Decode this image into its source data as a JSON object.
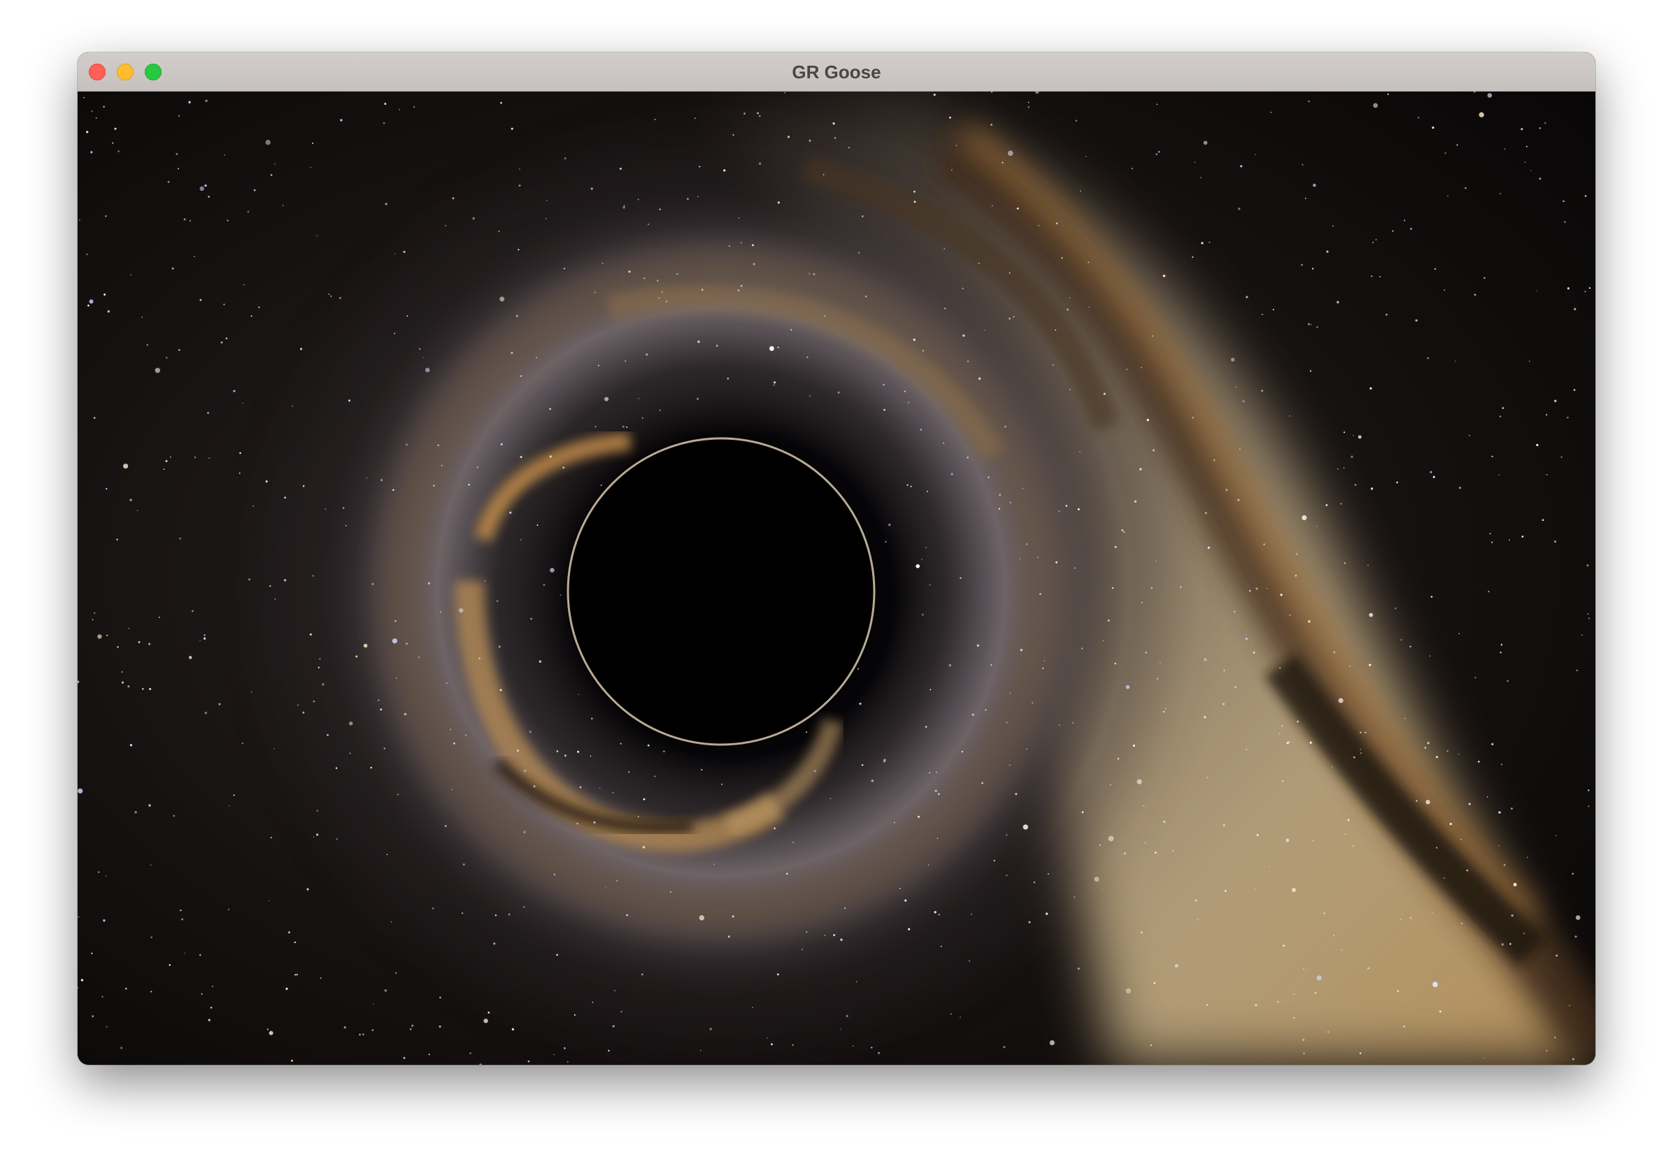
{
  "window": {
    "title": "GR Goose"
  },
  "controls": {
    "close_icon": "close-icon",
    "minimize_icon": "minimize-icon",
    "zoom_icon": "zoom-icon"
  },
  "colors": {
    "close": "#fe5f57",
    "minimize": "#febc2e",
    "zoom": "#28c840",
    "titlebar": "#cbc6c4",
    "title_text": "#4a4644"
  },
  "render": {
    "scene": "black-hole-lensing-milky-way"
  }
}
